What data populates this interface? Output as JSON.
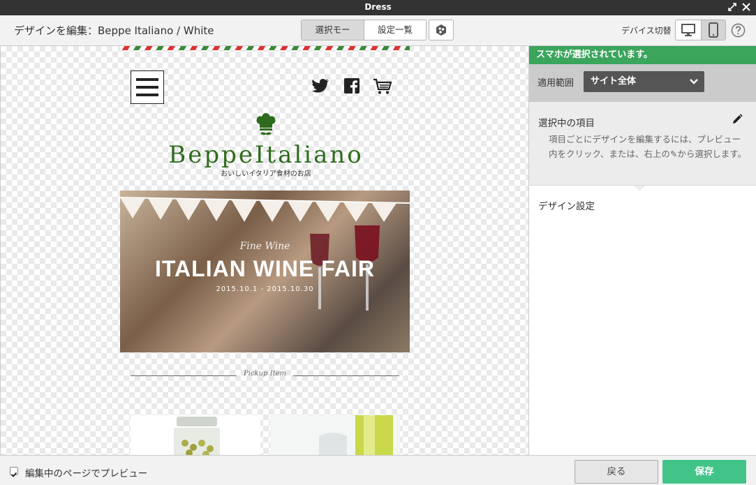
{
  "window": {
    "title": "Dress"
  },
  "toolbar": {
    "heading": "デザインを編集：Beppe Italiano / White",
    "mode_select": "選択モード",
    "mode_settings": "設定一覧",
    "device_label": "デバイス切替"
  },
  "preview": {
    "brand": "BeppeItaliano",
    "tagline": "おいしいイタリア食材のお店",
    "banner_script": "Fine Wine",
    "banner_title": "ITALIAN WINE FAIR",
    "banner_dates": "2015.10.1 - 2015.10.30",
    "pickup_label": "Pickup Item"
  },
  "panel": {
    "notice": "スマホが選択されています。",
    "scope_label": "適用範囲",
    "scope_value": "サイト全体",
    "selected_heading": "選択中の項目",
    "selected_desc": "項目ごとにデザインを編集するには、プレビュー内をクリック、または、右上の✎から選択します。",
    "design_heading": "デザイン設定"
  },
  "footer": {
    "preview_checkbox_label": "編集中のページでプレビュー",
    "preview_checked": true,
    "back_label": "戻る",
    "save_label": "保存"
  },
  "colors": {
    "accent_green": "#3ba55c",
    "save_green": "#42c488",
    "brand_green": "#2e6b1d"
  }
}
